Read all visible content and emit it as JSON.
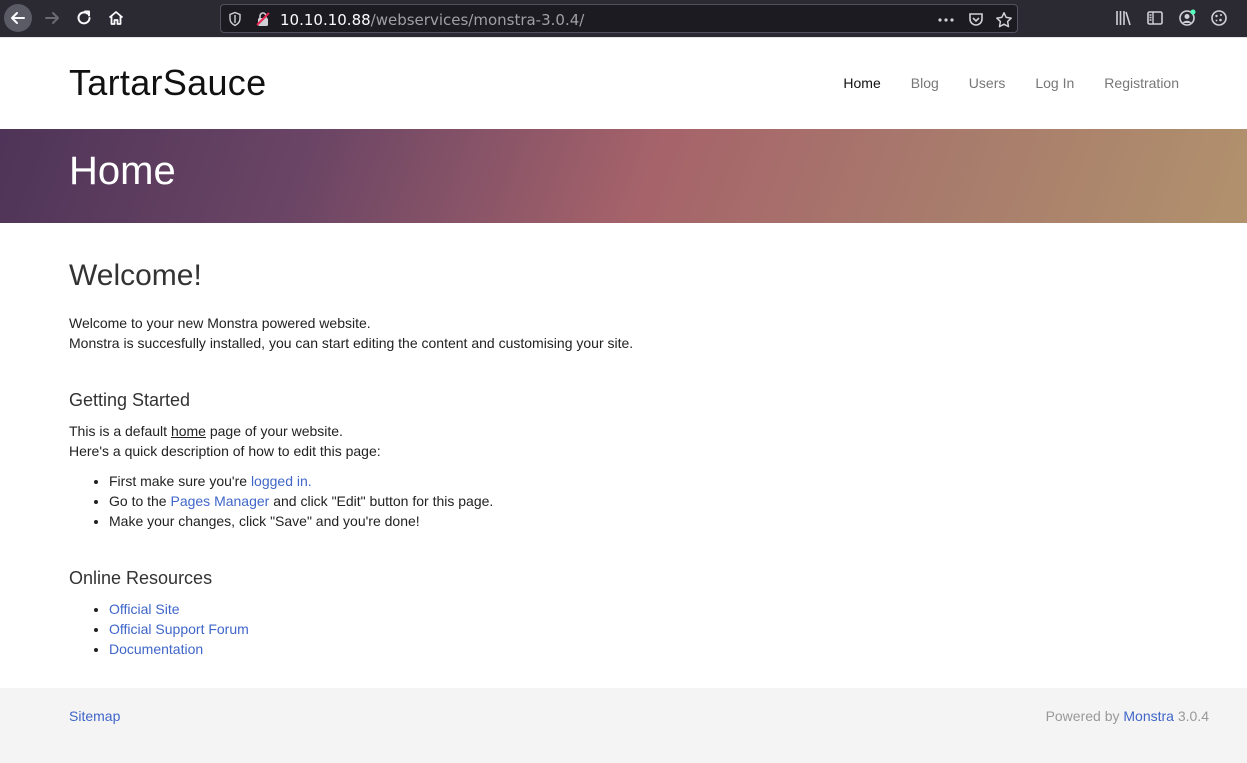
{
  "browser": {
    "url_host": "10.10.10.88",
    "url_path": "/webservices/monstra-3.0.4/"
  },
  "site": {
    "brand": "TartarSauce",
    "nav": [
      "Home",
      "Blog",
      "Users",
      "Log In",
      "Registration"
    ],
    "hero_title": "Home"
  },
  "content": {
    "welcome_title": "Welcome!",
    "welcome_line1": "Welcome to your new Monstra powered website.",
    "welcome_line2": "Monstra is succesfully installed, you can start editing the content and customising your site.",
    "getting_started_title": "Getting Started",
    "gs_line1_pre": "This is a default ",
    "gs_line1_link": "home",
    "gs_line1_post": " page of your website.",
    "gs_line2": "Here's a quick description of how to edit this page:",
    "step1_pre": "First make sure you're ",
    "step1_link": "logged in.",
    "step2_pre": "Go to the ",
    "step2_link": "Pages Manager",
    "step2_post": " and click \"Edit\" button for this page.",
    "step3": "Make your changes, click \"Save\" and you're done!",
    "resources_title": "Online Resources",
    "resources": [
      "Official Site",
      "Official Support Forum",
      "Documentation"
    ]
  },
  "footer": {
    "sitemap": "Sitemap",
    "powered_pre": "Powered by ",
    "powered_link": "Monstra",
    "powered_version": " 3.0.4"
  },
  "colors": {
    "link": "#3f66c8",
    "toolbar": "#2b2a33",
    "hero_start": "#4e3458",
    "hero_mid": "#a6636a",
    "hero_end": "#b1926d"
  }
}
